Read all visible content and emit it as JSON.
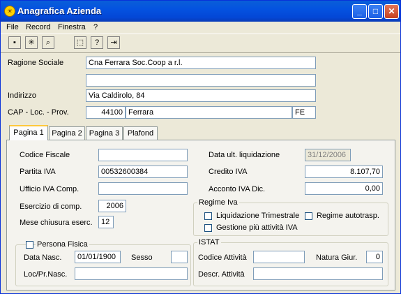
{
  "window": {
    "title": "Anagrafica Azienda",
    "app_icon": "sun-icon"
  },
  "menu": [
    "File",
    "Record",
    "Finestra",
    "?"
  ],
  "toolbar": {
    "icons": [
      "save-icon",
      "cancel-icon",
      "search-icon",
      "new-record-icon",
      "help-icon",
      "exit-icon"
    ]
  },
  "company": {
    "ragione_label": "Ragione Sociale",
    "ragione_1": "Cna Ferrara Soc.Coop a r.l.",
    "ragione_2": "",
    "indirizzo_label": "Indirizzo",
    "indirizzo": "Via Caldirolo, 84",
    "cap_label": "CAP - Loc. - Prov.",
    "cap": "44100",
    "localita": "Ferrara",
    "provincia": "FE"
  },
  "tabs": [
    "Pagina 1",
    "Pagina 2",
    "Pagina 3",
    "Plafond"
  ],
  "page1": {
    "codice_fiscale_label": "Codice Fiscale",
    "codice_fiscale": "",
    "partita_iva_label": "Partita IVA",
    "partita_iva": "00532600384",
    "ufficio_iva_label": "Ufficio IVA Comp.",
    "ufficio_iva": "",
    "esercizio_label": "Esercizio di comp.",
    "esercizio": "2006",
    "mese_label": "Mese chiusura eserc.",
    "mese": "12",
    "data_liq_label": "Data ult. liquidazione",
    "data_liq": "31/12/2006",
    "credito_label": "Credito IVA",
    "credito": "8.107,70",
    "acconto_label": "Acconto IVA Dic.",
    "acconto": "0,00",
    "regime_title": "Regime Iva",
    "liq_trim": "Liquidazione Trimestrale",
    "regime_auto": "Regime autotrasp.",
    "gest_multi": "Gestione più attività IVA",
    "persona_title": "Persona Fisica",
    "data_nasc_label": "Data Nasc.",
    "data_nasc": "01/01/1900",
    "sesso_label": "Sesso",
    "sesso": "",
    "loc_nasc_label": "Loc/Pr.Nasc.",
    "loc_nasc": "",
    "istat_title": "ISTAT",
    "codice_att_label": "Codice Attività",
    "codice_att": "",
    "natura_label": "Natura Giur.",
    "natura": "0",
    "descr_att_label": "Descr. Attività",
    "descr_att": ""
  }
}
